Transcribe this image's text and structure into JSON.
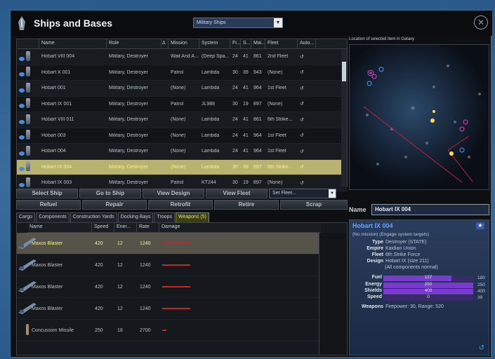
{
  "window": {
    "title": "Ships and Bases",
    "filter": "Military Ships",
    "close": "✕"
  },
  "table": {
    "columns": [
      "Name",
      "Role",
      "Mission",
      "System",
      "Fi...",
      "S...",
      "Mai...",
      "Fleet",
      "Auto..."
    ],
    "sort_indicator": "Δ",
    "rows": [
      {
        "name": "Hobart VIII 004",
        "role": "Military, Destroyer",
        "mission": "Wait And A...",
        "system": "(Deep Spa...",
        "fi": "24",
        "s": "41",
        "mai": "861",
        "fleet": "2nd Fleet",
        "auto": "↺"
      },
      {
        "name": "Hobart X 001",
        "role": "Military, Destroyer",
        "mission": "Patrol",
        "system": "Lambda",
        "fi": "30",
        "s": "39",
        "mai": "943",
        "fleet": "(None)",
        "auto": "↺"
      },
      {
        "name": "Hobart 001",
        "role": "Military, Destroyer",
        "mission": "(None)",
        "system": "Lambda",
        "fi": "24",
        "s": "41",
        "mai": "964",
        "fleet": "1st Fleet",
        "auto": "↺"
      },
      {
        "name": "Hobart IX 001",
        "role": "Military, Destroyer",
        "mission": "Patrol",
        "system": "JL988",
        "fi": "30",
        "s": "19",
        "mai": "897",
        "fleet": "(None)",
        "auto": "↺"
      },
      {
        "name": "Hobart VIII 011",
        "role": "Military, Destroyer",
        "mission": "(None)",
        "system": "Lambda",
        "fi": "24",
        "s": "41",
        "mai": "861",
        "fleet": "6th Strike...",
        "auto": "↺"
      },
      {
        "name": "Hobart 003",
        "role": "Military, Destroyer",
        "mission": "(None)",
        "system": "Lambda",
        "fi": "24",
        "s": "41",
        "mai": "964",
        "fleet": "1st Fleet",
        "auto": "↺"
      },
      {
        "name": "Hobart 004",
        "role": "Military, Destroyer",
        "mission": "(None)",
        "system": "Lambda",
        "fi": "24",
        "s": "41",
        "mai": "964",
        "fleet": "1st Fleet",
        "auto": "↺"
      },
      {
        "name": "Hobart IX 004",
        "role": "Military, Destroyer",
        "mission": "(None)",
        "system": "Lambda",
        "fi": "30",
        "s": "39",
        "mai": "897",
        "fleet": "6th Strike...",
        "auto": "↺",
        "selected": true
      },
      {
        "name": "Hobart IX 003",
        "role": "Military, Destroyer",
        "mission": "Patrol",
        "system": "KT244",
        "fi": "30",
        "s": "19",
        "mai": "897",
        "fleet": "(None)",
        "auto": "↺"
      }
    ]
  },
  "buttons": {
    "row1": [
      "Select Ship",
      "Go to Ship",
      "View Design",
      "View Fleet"
    ],
    "set_fleet": "Set Fleet...",
    "row2": [
      "Refuel",
      "Repair",
      "Retrofit",
      "Retire",
      "Scrap"
    ]
  },
  "tabs": [
    "Cargo",
    "Components",
    "Construction Yards",
    "Docking Bays",
    "Troops",
    "Weapons (5)"
  ],
  "weapons": {
    "columns": [
      "Name",
      "Speed",
      "Ener...",
      "Rate",
      "Damage"
    ],
    "rows": [
      {
        "name": "Maxos Blaster",
        "speed": "420",
        "energy": "12",
        "rate": "1240",
        "selected": true
      },
      {
        "name": "Maxos Blaster",
        "speed": "420",
        "energy": "12",
        "rate": "1240"
      },
      {
        "name": "Maxos Blaster",
        "speed": "420",
        "energy": "12",
        "rate": "1240"
      },
      {
        "name": "Maxos Blaster",
        "speed": "420",
        "energy": "12",
        "rate": "1240"
      },
      {
        "name": "Concussion Missile",
        "speed": "250",
        "energy": "18",
        "rate": "2700"
      }
    ]
  },
  "map": {
    "label": "Location of selected item in Galaxy"
  },
  "name_field": {
    "label": "Name",
    "value": "Hobart IX 004"
  },
  "info": {
    "title": "Hobart IX 004",
    "mission": "(No mission) (Engage system targets)",
    "type_label": "Type",
    "type": "Destroyer (STATE)",
    "empire_label": "Empire",
    "empire": "Kaidian Union",
    "fleet_label": "Fleet",
    "fleet": "6th Strike Force",
    "design_label": "Design",
    "design": "Hobart IX (size 211)",
    "components": "(All components normal)",
    "fuel_label": "Fuel",
    "fuel": "137",
    "fuel_max": "180",
    "fuel_frac": 0.76,
    "energy_label": "Energy",
    "energy": "250",
    "energy_max": "250",
    "energy_frac": 1.0,
    "shields_label": "Shields",
    "shields": "400",
    "shields_max": "400",
    "shields_frac": 1.0,
    "speed_label": "Speed",
    "speed": "0",
    "speed_max": "39",
    "speed_frac": 0.0,
    "weapons_label": "Weapons",
    "weapons": "Firepower: 30, Range: 520"
  }
}
